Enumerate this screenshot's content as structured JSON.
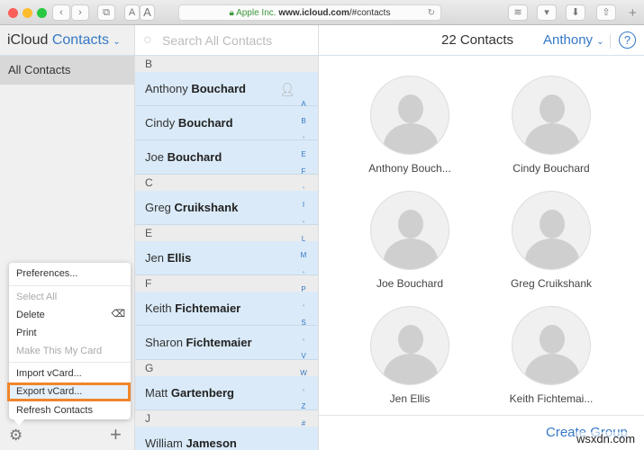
{
  "browser": {
    "url_company": "Apple Inc.",
    "url_domain": "www.icloud.com",
    "url_path": "/#contacts",
    "font_small": "A",
    "font_large": "A"
  },
  "header": {
    "app": "iCloud",
    "section": "Contacts",
    "count": "22 Contacts",
    "user": "Anthony",
    "help": "?"
  },
  "sidebar": {
    "all_contacts": "All Contacts"
  },
  "search": {
    "placeholder": "Search All Contacts"
  },
  "list": [
    {
      "type": "header",
      "label": "B"
    },
    {
      "type": "contact",
      "first": "Anthony",
      "last": "Bouchard",
      "me": true
    },
    {
      "type": "contact",
      "first": "Cindy",
      "last": "Bouchard"
    },
    {
      "type": "contact",
      "first": "Joe",
      "last": "Bouchard"
    },
    {
      "type": "header",
      "label": "C"
    },
    {
      "type": "contact",
      "first": "Greg",
      "last": "Cruikshank"
    },
    {
      "type": "header",
      "label": "E"
    },
    {
      "type": "contact",
      "first": "Jen",
      "last": "Ellis"
    },
    {
      "type": "header",
      "label": "F"
    },
    {
      "type": "contact",
      "first": "Keith",
      "last": "Fichtemaier"
    },
    {
      "type": "contact",
      "first": "Sharon",
      "last": "Fichtemaier"
    },
    {
      "type": "header",
      "label": "G"
    },
    {
      "type": "contact",
      "first": "Matt",
      "last": "Gartenberg"
    },
    {
      "type": "header",
      "label": "J"
    },
    {
      "type": "contact",
      "first": "William",
      "last": "Jameson"
    }
  ],
  "index": [
    "A",
    "B",
    "•",
    "E",
    "F",
    "•",
    "I",
    "•",
    "L",
    "M",
    "•",
    "P",
    "•",
    "S",
    "•",
    "V",
    "W",
    "•",
    "Z",
    "#"
  ],
  "cards": [
    "Anthony Bouch...",
    "Cindy Bouchard",
    "Joe Bouchard",
    "Greg Cruikshank",
    "Jen Ellis",
    "Keith Fichtemai..."
  ],
  "menu": {
    "preferences": "Preferences...",
    "select_all": "Select All",
    "delete": "Delete",
    "print": "Print",
    "make_my_card": "Make This My Card",
    "import": "Import vCard...",
    "export": "Export vCard...",
    "refresh": "Refresh Contacts"
  },
  "footer": {
    "create_group": "Create Group"
  },
  "watermark": "wsxdn.com"
}
